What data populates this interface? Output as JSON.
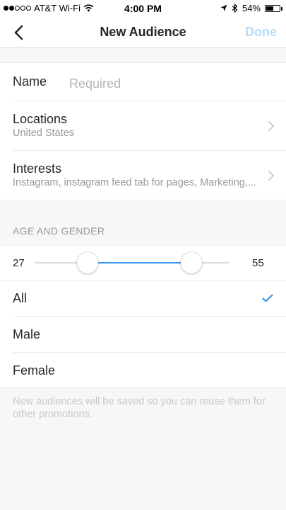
{
  "status_bar": {
    "carrier": "AT&T Wi-Fi",
    "time": "4:00 PM",
    "battery_percent": "54%",
    "battery_level": 0.54,
    "signal_dots_filled": 2,
    "signal_dots_total": 5
  },
  "nav": {
    "title": "New Audience",
    "done_label": "Done",
    "back_icon": "chevron-left-icon"
  },
  "form": {
    "name": {
      "label": "Name",
      "value": "",
      "placeholder": "Required"
    },
    "locations": {
      "label": "Locations",
      "value": "United States"
    },
    "interests": {
      "label": "Interests",
      "value": "Instagram, instagram feed tab for pages, Marketing,..."
    }
  },
  "age_gender": {
    "header": "AGE AND GENDER",
    "age_min": "27",
    "age_max": "55",
    "age_range_limits": [
      13,
      65
    ],
    "options": [
      {
        "label": "All",
        "selected": true
      },
      {
        "label": "Male",
        "selected": false
      },
      {
        "label": "Female",
        "selected": false
      }
    ]
  },
  "footer_note": "New audiences will be saved so you can reuse them for other promotions.",
  "colors": {
    "accent": "#3897f0",
    "done_disabled": "#b9dcf7",
    "text_primary": "#262626",
    "text_secondary": "#999999",
    "background": "#f7f7f7"
  }
}
